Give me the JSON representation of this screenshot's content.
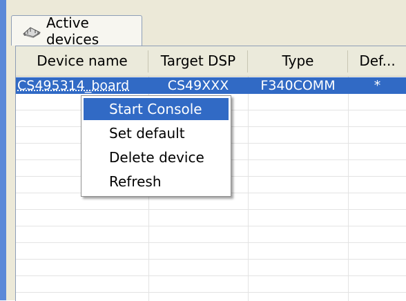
{
  "tab": {
    "label": "Active devices",
    "icon": "chip-icon"
  },
  "table": {
    "columns": [
      "Device name",
      "Target DSP",
      "Type",
      "Def..."
    ],
    "rows": [
      [
        "CS495314_board",
        "CS49XXX",
        "F340COMM",
        "*"
      ]
    ]
  },
  "context_menu": {
    "items": [
      "Start Console",
      "Set default",
      "Delete device",
      "Refresh"
    ],
    "highlighted": "Start Console"
  },
  "colors": {
    "selection": "#316ac5",
    "frame": "#ece9d8",
    "border_accent": "#5b89d8"
  }
}
